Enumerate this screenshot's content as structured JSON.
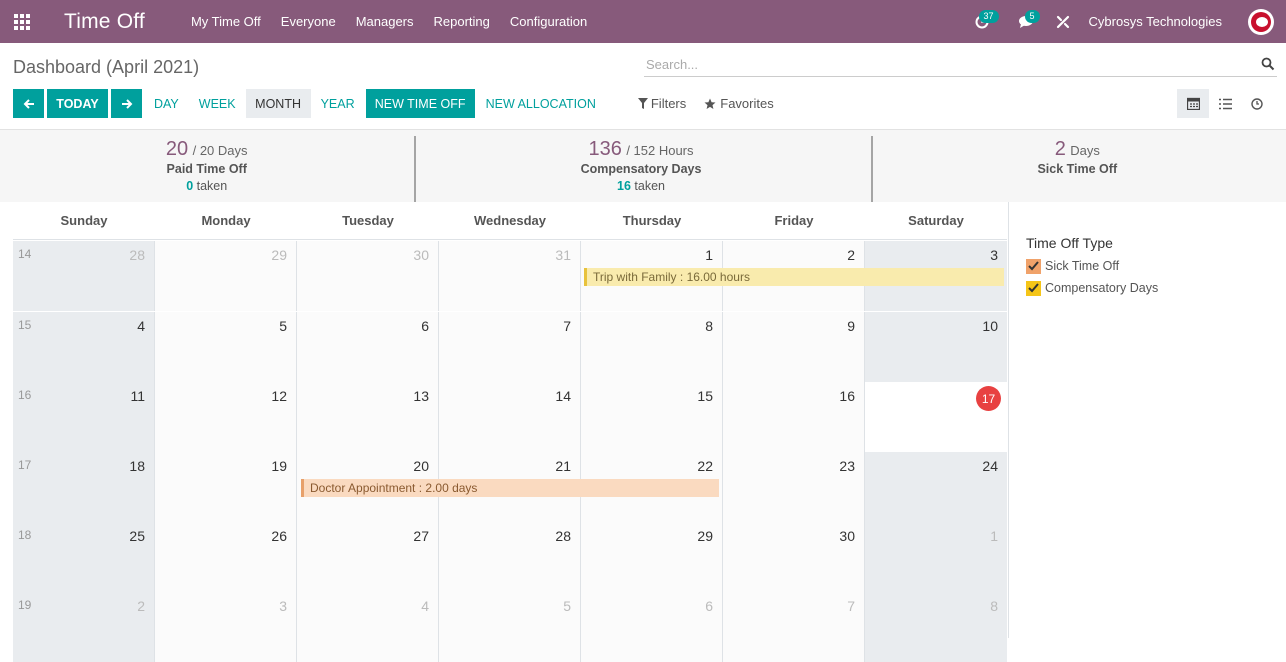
{
  "navbar": {
    "app_title": "Time Off",
    "menu": [
      "My Time Off",
      "Everyone",
      "Managers",
      "Reporting",
      "Configuration"
    ],
    "activity_count": "37",
    "message_count": "5",
    "company": "Cybrosys Technologies"
  },
  "control": {
    "title": "Dashboard (April 2021)",
    "search_placeholder": "Search...",
    "today": "TODAY",
    "day": "DAY",
    "week": "WEEK",
    "month": "MONTH",
    "year": "YEAR",
    "new_time_off": "NEW TIME OFF",
    "new_allocation": "NEW ALLOCATION",
    "filters": "Filters",
    "favorites": "Favorites"
  },
  "stats": [
    {
      "value": "20",
      "total": "/ 20 Days",
      "name": "Paid Time Off",
      "taken_num": "0",
      "taken_label": "taken"
    },
    {
      "value": "136",
      "total": "/ 152 Hours",
      "name": "Compensatory Days",
      "taken_num": "16",
      "taken_label": "taken"
    },
    {
      "value": "2",
      "total": "Days",
      "name": "Sick Time Off"
    }
  ],
  "calendar": {
    "weekdays": [
      "Sunday",
      "Monday",
      "Tuesday",
      "Wednesday",
      "Thursday",
      "Friday",
      "Saturday"
    ],
    "weeks": [
      {
        "wk": "14",
        "days": [
          "28",
          "29",
          "30",
          "31",
          "1",
          "2",
          "3"
        ]
      },
      {
        "wk": "15",
        "days": [
          "4",
          "5",
          "6",
          "7",
          "8",
          "9",
          "10"
        ]
      },
      {
        "wk": "16",
        "days": [
          "11",
          "12",
          "13",
          "14",
          "15",
          "16",
          "17"
        ]
      },
      {
        "wk": "17",
        "days": [
          "18",
          "19",
          "20",
          "21",
          "22",
          "23",
          "24"
        ]
      },
      {
        "wk": "18",
        "days": [
          "25",
          "26",
          "27",
          "28",
          "29",
          "30",
          "1"
        ]
      },
      {
        "wk": "19",
        "days": [
          "2",
          "3",
          "4",
          "5",
          "6",
          "7",
          "8"
        ]
      }
    ],
    "events": {
      "trip": "Trip with Family : 16.00 hours",
      "doctor": "Doctor Appointment : 2.00 days"
    }
  },
  "sidebar": {
    "title": "Time Off Type",
    "items": [
      "Sick Time Off",
      "Compensatory Days"
    ],
    "item_colors": [
      "#f0a26a",
      "#f5c518"
    ]
  },
  "colors": {
    "brand": "#875a7b",
    "accent": "#00a09d",
    "today": "#e84141"
  }
}
